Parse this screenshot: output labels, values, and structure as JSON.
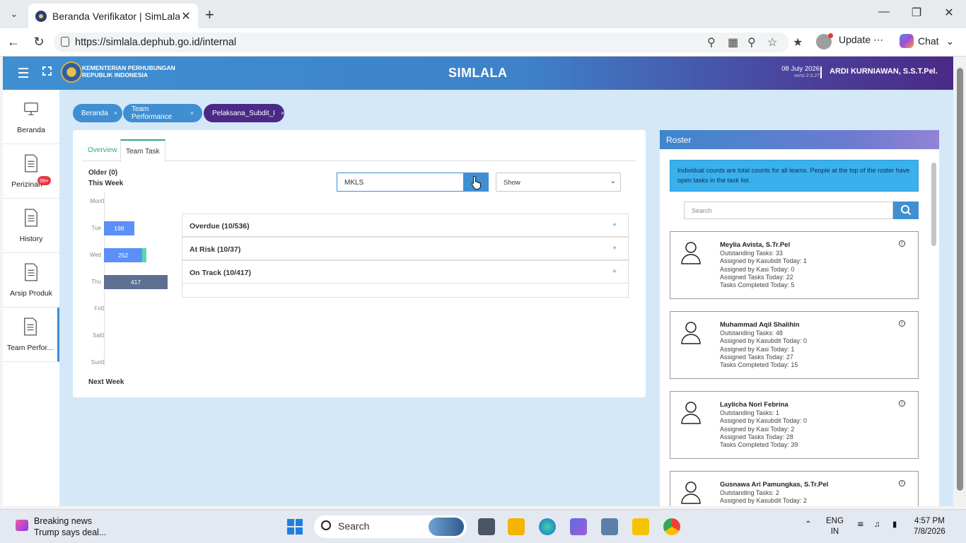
{
  "browser": {
    "tab_title": "Beranda Verifikator | SimLala",
    "url": "https://simlala.dephub.go.id/internal",
    "update_label": "Update",
    "chat_label": "Chat"
  },
  "header": {
    "ministry_line1": "KEMENTERIAN PERHUBUNGAN",
    "ministry_line2": "REPUBLIK INDONESIA",
    "app_title": "SIMLALA",
    "date": "08 July 2026",
    "version": "versi 2.0.27",
    "user": "ARDI KURNIAWAN, S.S.T.Pel."
  },
  "sidebar": {
    "items": [
      {
        "label": "Beranda",
        "icon": "monitor-icon"
      },
      {
        "label": "Perizinan",
        "icon": "document-icon",
        "badge": "99+"
      },
      {
        "label": "History",
        "icon": "document-icon"
      },
      {
        "label": "Arsip Produk",
        "icon": "document-icon"
      },
      {
        "label": "Team Perfor...",
        "icon": "document-icon"
      }
    ]
  },
  "breadcrumb": {
    "chips": [
      {
        "label": "Beranda",
        "color": "#3f8fd2"
      },
      {
        "label": "Team Performance",
        "color": "#3f8fd2"
      },
      {
        "label": "Pelaksana_Subdit_I",
        "color": "#4a2a86"
      }
    ],
    "close_glyph": "×"
  },
  "main": {
    "tabs": [
      "Overview",
      "Team Task"
    ],
    "older_label": "Older (0)",
    "this_week_label": "This Week",
    "next_week_label": "Next Week",
    "filter_value": "MKLS",
    "show_select": "Show",
    "sections": [
      {
        "label": "Overdue (10/536)",
        "glyph": "+"
      },
      {
        "label": "At Risk (10/37)",
        "glyph": "+"
      },
      {
        "label": "On Track (10/417)",
        "glyph": "+"
      }
    ]
  },
  "chart_data": {
    "type": "bar",
    "orientation": "horizontal",
    "categories": [
      "Mon",
      "Tue",
      "Wed",
      "Thu",
      "Fri",
      "Sat",
      "Sun"
    ],
    "series": [
      {
        "color": "#5b8ff9",
        "values": [
          0,
          198,
          252,
          0,
          0,
          0,
          0
        ]
      },
      {
        "color": "#5ad8a6",
        "values": [
          0,
          0,
          27,
          0,
          0,
          0,
          0
        ]
      },
      {
        "color": "#5d7092",
        "values": [
          0,
          0,
          0,
          417,
          0,
          0,
          0
        ]
      }
    ],
    "value_labels": [
      "0",
      "198",
      "252",
      "417",
      "0",
      "0",
      "0"
    ],
    "xlim": [
      0,
      417
    ]
  },
  "roster": {
    "title": "Roster",
    "info": "Individual counts are total counts for all teams. People at the top of the roster have open tasks in the task list.",
    "search_placeholder": "Search",
    "people": [
      {
        "name": "Meylia Avista, S.Tr.Pel",
        "lines": [
          "Outstanding Tasks: 33",
          "Assigned by Kasubdit Today: 1",
          "Assigned by Kasi Today: 0",
          "Assigned Tasks Today: 22",
          "Tasks Completed Today: 5"
        ]
      },
      {
        "name": "Muhammad Aqil Shalihin",
        "lines": [
          "Outstanding Tasks: 48",
          "Assigned by Kasubdit Today: 0",
          "Assigned by Kasi Today: 1",
          "Assigned Tasks Today: 27",
          "Tasks Completed Today: 15"
        ]
      },
      {
        "name": "Laylicha Nori Febrina",
        "lines": [
          "Outstanding Tasks: 1",
          "Assigned by Kasubdit Today: 0",
          "Assigned by Kasi Today: 2",
          "Assigned Tasks Today: 28",
          "Tasks Completed Today: 39"
        ]
      },
      {
        "name": "Gusnawa Ari Pamungkas, S.Tr.Pel",
        "lines": [
          "Outstanding Tasks: 2",
          "Assigned by Kasubdit Today: 2"
        ]
      }
    ]
  },
  "taskbar": {
    "news_title": "Breaking news",
    "news_sub": "Trump says deal...",
    "search_label": "Search",
    "lang1": "ENG",
    "lang2": "IN",
    "time": "4:57 PM",
    "date": "7/8/2026"
  }
}
